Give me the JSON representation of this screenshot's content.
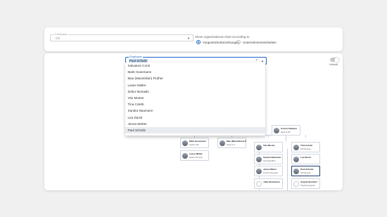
{
  "filters": {
    "company": {
      "label": "Company",
      "value": "CS"
    },
    "option_title": "Show organizational chart according to",
    "options": [
      {
        "label": "Vorgesetztenbeziehungen",
        "selected": true
      },
      {
        "label": "Unternehmenseinheiten",
        "selected": false
      }
    ]
  },
  "employee": {
    "label": "Employee",
    "value": "Paul Schultz",
    "options": [
      "Salvatore Conti",
      "Mark Husemann",
      "Max (Maximilian) Fluther",
      "Lasse Müller",
      "Zeltor Moriaski",
      "Vito Muster",
      "Tina Coletti",
      "Sandra Naumann",
      "Lea David",
      "Jenna Weber",
      "Paul Schultz"
    ]
  },
  "toggle": {
    "label": "Unlock",
    "on": false
  },
  "org_cards": [
    {
      "name": "Corina Xhinkuri",
      "role": "Head of HR",
      "selected": false,
      "photo": true
    },
    {
      "name": "Mark Husemann",
      "role": "Head of HR",
      "selected": false,
      "photo": true
    },
    {
      "name": "Max (Maximilian) Fluther",
      "role": "Head of IT",
      "selected": false,
      "photo": true
    },
    {
      "name": "Vito Muster",
      "role": "",
      "selected": false,
      "photo": true
    },
    {
      "name": "Tina Coletti",
      "role": "HR Manager",
      "selected": false,
      "photo": true
    },
    {
      "name": "Lasse Müller",
      "role": "Head of Product",
      "selected": false,
      "photo": true
    },
    {
      "name": "Sandra Naumann",
      "role": "Sekretärin/Büro",
      "selected": false,
      "photo": true
    },
    {
      "name": "Lea David",
      "role": "",
      "selected": false,
      "photo": true
    },
    {
      "name": "Jenna Weber",
      "role": "Product Developer",
      "selected": false,
      "photo": true
    },
    {
      "name": "Paul Schultz",
      "role": "HR Manager",
      "selected": true,
      "photo": true
    },
    {
      "name": "Julia Steinmann",
      "role": "",
      "selected": false,
      "photo": false
    },
    {
      "name": "Angela Steinhirt",
      "role": "Projektmanager/in",
      "selected": false,
      "photo": false
    }
  ],
  "colors": {
    "accent": "#1e66c8",
    "selected_card_border": "#1a3c70",
    "highlight": "#c5dbf7"
  }
}
